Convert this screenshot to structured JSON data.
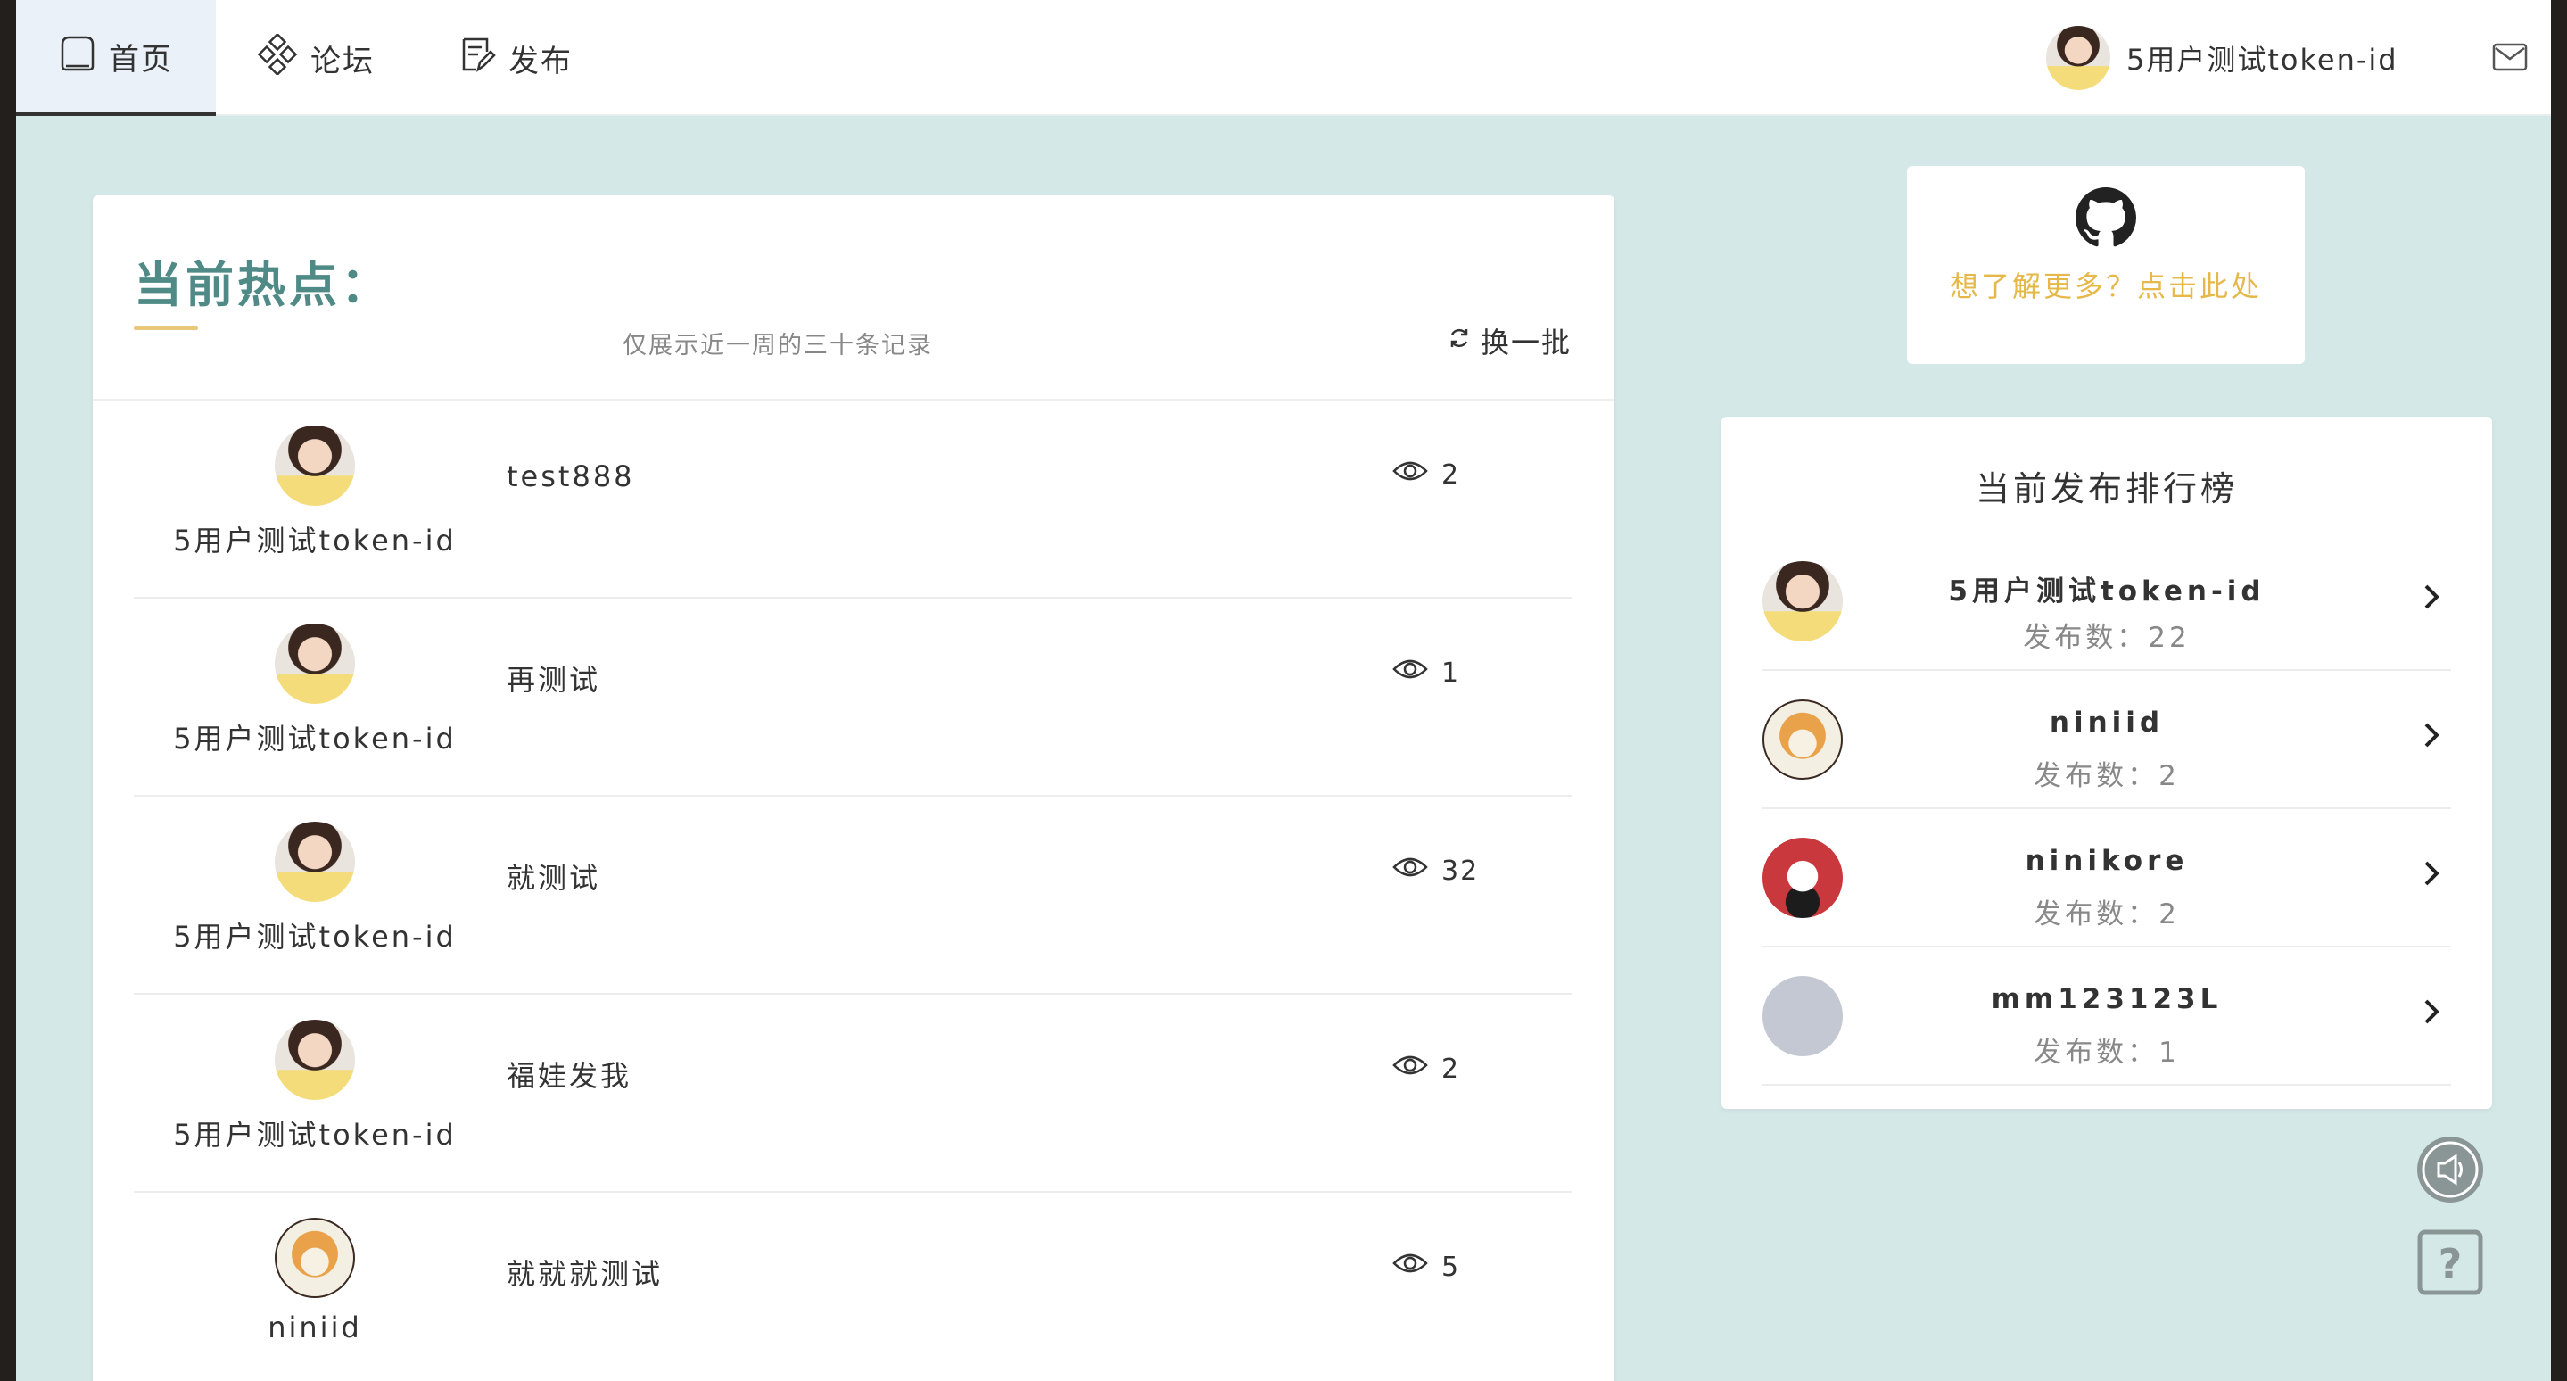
{
  "nav": {
    "home_label": "首页",
    "forum_label": "论坛",
    "publish_label": "发布",
    "user_name": "5用户测试token-id"
  },
  "hot": {
    "title": "当前热点：",
    "subtitle": "仅展示近一周的三十条记录",
    "refresh_label": "换一批",
    "posts": [
      {
        "author": "5用户测试token-id",
        "title": "test888",
        "views": "2"
      },
      {
        "author": "5用户测试token-id",
        "title": "再测试",
        "views": "1"
      },
      {
        "author": "5用户测试token-id",
        "title": "就测试",
        "views": "32"
      },
      {
        "author": "5用户测试token-id",
        "title": "福娃发我",
        "views": "2"
      },
      {
        "author": "niniid",
        "title": "就就就测试",
        "views": "5"
      }
    ]
  },
  "more": {
    "icon": "github-icon",
    "text": "想了解更多？点击此处",
    "color": "#e6b84a"
  },
  "rank": {
    "title": "当前发布排行榜",
    "entries": [
      {
        "name": "5用户测试token-id",
        "count": "发布数：22"
      },
      {
        "name": "niniid",
        "count": "发布数：2"
      },
      {
        "name": "ninikore",
        "count": "发布数：2"
      },
      {
        "name": "mm123123L",
        "count": "发布数：1"
      }
    ]
  },
  "theme": {
    "background": "#d5e8e8",
    "title_color": "#4f8a87",
    "accent_underline": "#e8c77a"
  }
}
